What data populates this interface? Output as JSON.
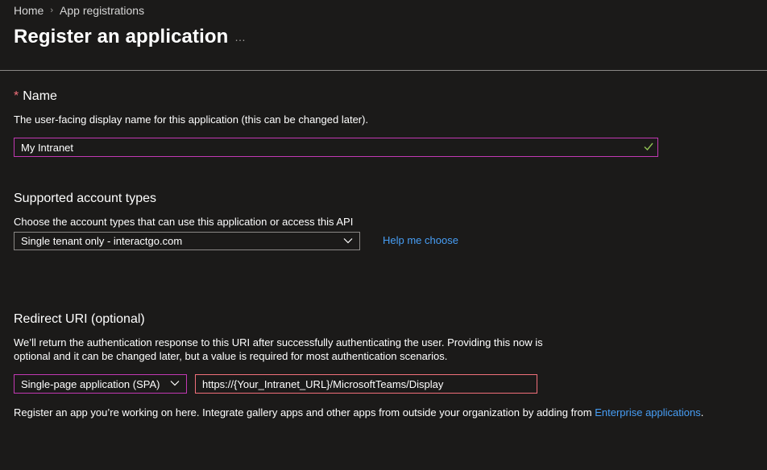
{
  "breadcrumb": {
    "home": "Home",
    "separator": "›",
    "current": "App registrations"
  },
  "page": {
    "title": "Register an application",
    "more_icon": "…"
  },
  "name_section": {
    "required_marker": "*",
    "heading": "Name",
    "description": "The user-facing display name for this application (this can be changed later).",
    "input_value": "My Intranet",
    "valid_icon": "checkmark-icon"
  },
  "account_types": {
    "heading": "Supported account types",
    "description": "Choose the account types that can use this application or access this API",
    "selected": "Single tenant only - interactgo.com",
    "help_link": "Help me choose"
  },
  "redirect": {
    "heading": "Redirect URI (optional)",
    "description_line1": "We’ll return the authentication response to this URI after successfully authenticating the user. Providing this now is",
    "description_line2": "optional and it can be changed later, but a value is required for most authentication scenarios.",
    "platform_selected": "Single-page application (SPA)",
    "uri_value": "https://{Your_Intranet_URL}/MicrosoftTeams/Display"
  },
  "footer": {
    "text": "Register an app you’re working on here. Integrate gallery apps and other apps from outside your organization by adding from ",
    "link": "Enterprise applications",
    "end": "."
  },
  "colors": {
    "background": "#1b1a19",
    "focus_border": "#c239b3",
    "error_border": "#f1707b",
    "link": "#479ef5",
    "required": "#f1707b",
    "valid_check": "#92c353"
  }
}
